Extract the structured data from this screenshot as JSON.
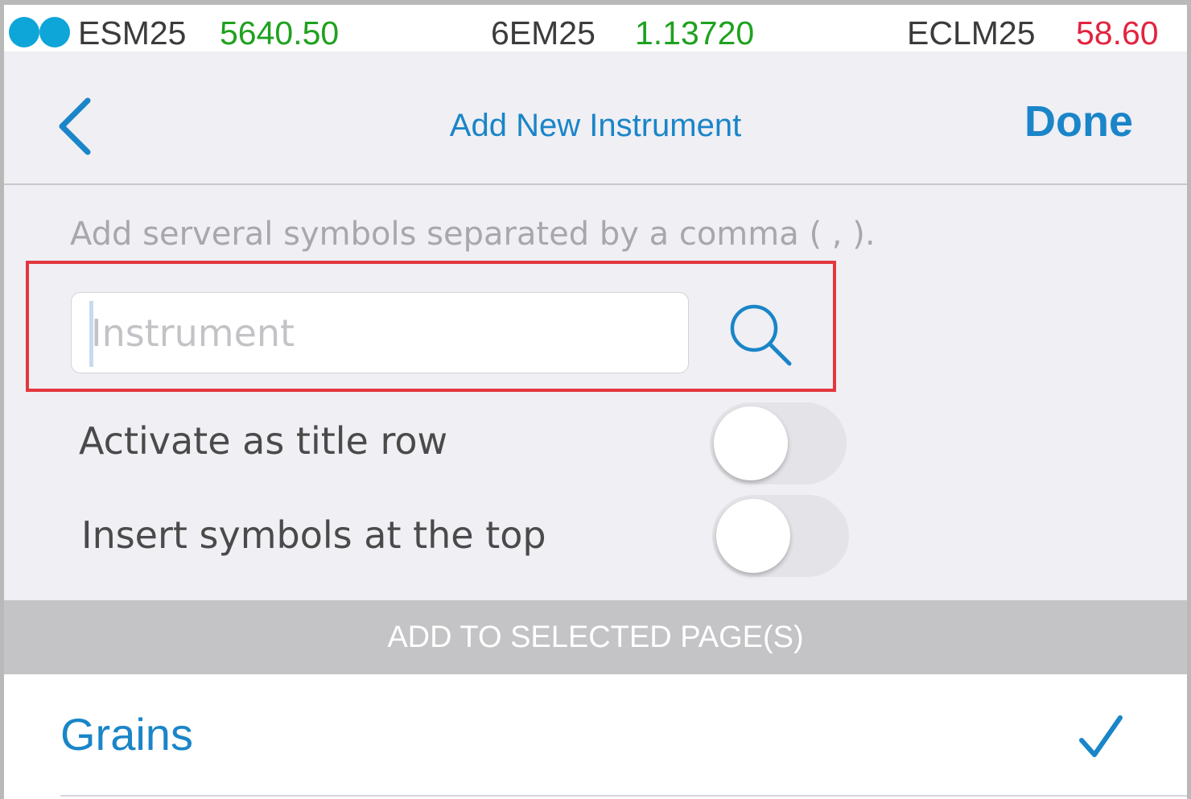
{
  "ticker": {
    "items": [
      {
        "symbol": "ESM25",
        "price": "5640.50",
        "direction": "up"
      },
      {
        "symbol": "6EM25",
        "price": "1.13720",
        "direction": "up"
      },
      {
        "symbol": "ECLM25",
        "price": "58.60",
        "direction": "down"
      }
    ]
  },
  "nav": {
    "title": "Add New Instrument",
    "back_icon": "chevron-left-icon",
    "done_label": "Done"
  },
  "form": {
    "hint": "Add serveral symbols separated by a comma ( , ).",
    "instrument_placeholder": "Instrument",
    "instrument_value": "",
    "search_icon": "search-icon"
  },
  "toggles": [
    {
      "label": "Activate as title row",
      "on": false
    },
    {
      "label": "Insert symbols at the top",
      "on": false
    }
  ],
  "pages_section": {
    "header": "ADD TO SELECTED PAGE(S)",
    "items": [
      {
        "label": "Grains",
        "selected": true
      }
    ]
  },
  "colors": {
    "accent": "#1a85c8",
    "up": "#1fa11f",
    "down": "#e3233f",
    "highlight": "#e2373d"
  }
}
